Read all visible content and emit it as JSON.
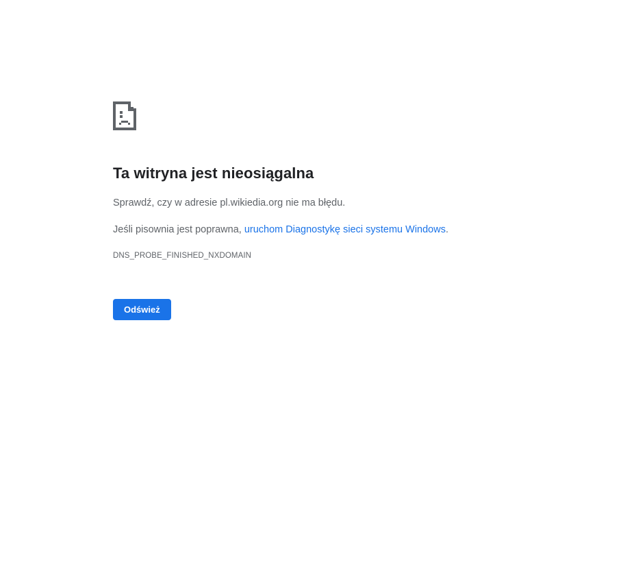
{
  "error": {
    "icon": "sad-document-icon",
    "title": "Ta witryna jest nieosiągalna",
    "check_message": "Sprawdź, czy w adresie pl.wikiedia.org nie ma błędu.",
    "spell_prefix": "Jeśli pisownia jest poprawna, ",
    "diagnostics_link": "uruchom Diagnostykę sieci systemu Windows",
    "spell_suffix": ".",
    "code": "DNS_PROBE_FINISHED_NXDOMAIN"
  },
  "buttons": {
    "reload_label": "Odśwież"
  },
  "colors": {
    "accent": "#1a73e8",
    "text_primary": "#202124",
    "text_secondary": "#5f6368",
    "icon": "#5f6368"
  }
}
